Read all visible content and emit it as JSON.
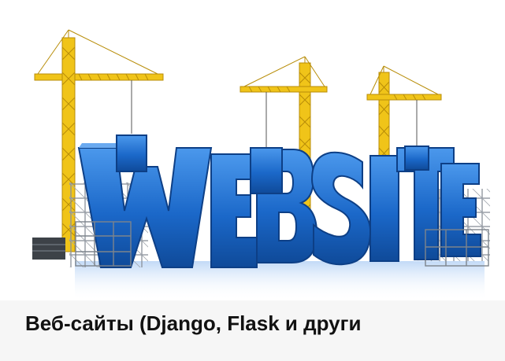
{
  "image": {
    "alt": "WEBSITE",
    "letters": [
      "W",
      "E",
      "B",
      "S",
      "I",
      "T",
      "E"
    ]
  },
  "caption": {
    "title": "Веб-сайты (Django, Flask и други"
  },
  "colors": {
    "caption_background": "#f6f6f6",
    "caption_text": "#111111",
    "letter_blue": "#1b68c9",
    "letter_blue_dark": "#0d3f86",
    "crane_yellow": "#f0c419"
  }
}
